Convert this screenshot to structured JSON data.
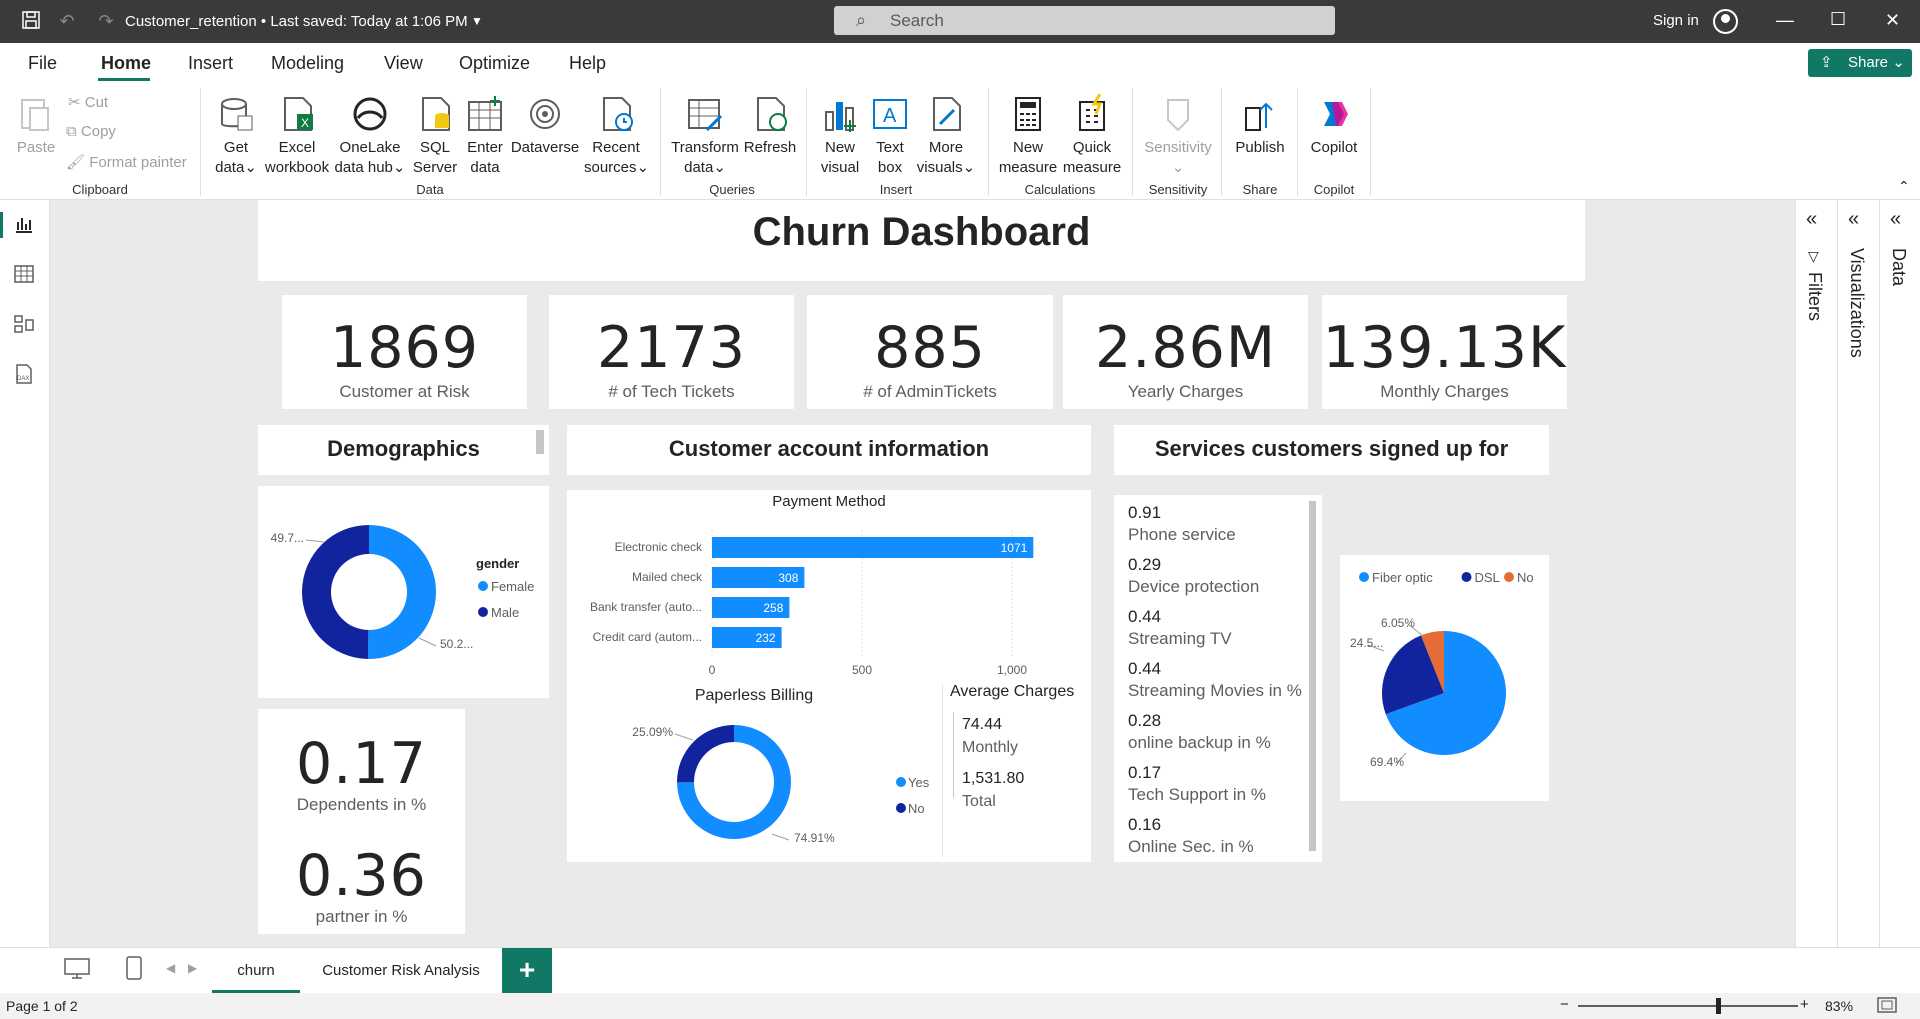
{
  "titlebar": {
    "document": "Customer_retention • Last saved: Today at 1:06 PM",
    "search_placeholder": "Search",
    "sign_in": "Sign in"
  },
  "menu": {
    "items": [
      "File",
      "Home",
      "Insert",
      "Modeling",
      "View",
      "Optimize",
      "Help"
    ],
    "share": "Share"
  },
  "ribbon": {
    "clipboard": {
      "paste": "Paste",
      "cut": "Cut",
      "copy": "Copy",
      "format_painter": "Format painter",
      "group": "Clipboard"
    },
    "data": {
      "get_data": [
        "Get",
        "data"
      ],
      "excel": [
        "Excel",
        "workbook"
      ],
      "onelake": [
        "OneLake",
        "data hub"
      ],
      "sql": [
        "SQL",
        "Server"
      ],
      "enter": [
        "Enter",
        "data"
      ],
      "dataverse": "Dataverse",
      "recent": [
        "Recent",
        "sources"
      ],
      "group": "Data"
    },
    "queries": {
      "transform": [
        "Transform",
        "data"
      ],
      "refresh": "Refresh",
      "group": "Queries"
    },
    "insert": {
      "new_visual": [
        "New",
        "visual"
      ],
      "text_box": [
        "Text",
        "box"
      ],
      "more_visuals": [
        "More",
        "visuals"
      ],
      "group": "Insert"
    },
    "calculations": {
      "new_measure": [
        "New",
        "measure"
      ],
      "quick_measure": [
        "Quick",
        "measure"
      ],
      "group": "Calculations"
    },
    "sensitivity": {
      "label": "Sensitivity",
      "group": "Sensitivity"
    },
    "share": {
      "publish": "Publish",
      "group": "Share"
    },
    "copilot": {
      "label": "Copilot",
      "group": "Copilot"
    }
  },
  "dashboard": {
    "title": "Churn Dashboard",
    "kpis": [
      {
        "value": "1869",
        "label": "Customer at Risk"
      },
      {
        "value": "2173",
        "label": "# of Tech Tickets"
      },
      {
        "value": "885",
        "label": "# of AdminTickets"
      },
      {
        "value": "2.86M",
        "label": "Yearly Charges"
      },
      {
        "value": "139.13K",
        "label": "Monthly Charges"
      }
    ],
    "sections": {
      "demographics": "Demographics",
      "account": "Customer account information",
      "services": "Services customers signed up for"
    },
    "dependents": {
      "value": "0.17",
      "label": "Dependents in %"
    },
    "partner": {
      "value": "0.36",
      "label": "partner in %"
    },
    "average_charges": {
      "title": "Average Charges",
      "monthly_value": "74.44",
      "monthly_label": "Monthly",
      "total_value": "1,531.80",
      "total_label": "Total"
    },
    "services": [
      {
        "value": "0.91",
        "label": "Phone service"
      },
      {
        "value": "0.29",
        "label": "Device protection"
      },
      {
        "value": "0.44",
        "label": "Streaming TV"
      },
      {
        "value": "0.44",
        "label": "Streaming Movies in %"
      },
      {
        "value": "0.28",
        "label": "online backup in %"
      },
      {
        "value": "0.17",
        "label": "Tech Support in %"
      },
      {
        "value": "0.16",
        "label": "Online Sec. in %"
      }
    ]
  },
  "chart_data": [
    {
      "type": "pie",
      "legend_title": "gender",
      "categories": [
        "Female",
        "Male"
      ],
      "values": [
        50.2,
        49.7
      ],
      "data_labels": [
        "50.2...",
        "49.7..."
      ],
      "colors": [
        "#118dff",
        "#12239e"
      ],
      "donut": true
    },
    {
      "type": "bar",
      "orientation": "horizontal",
      "title": "Payment Method",
      "categories": [
        "Electronic check",
        "Mailed check",
        "Bank transfer (auto...",
        "Credit card (autom..."
      ],
      "values": [
        1071,
        308,
        258,
        232
      ],
      "x_ticks": [
        "0",
        "500",
        "1,000"
      ],
      "xlim": [
        0,
        1100
      ],
      "color": "#118dff"
    },
    {
      "type": "pie",
      "title": "Paperless Billing",
      "categories": [
        "Yes",
        "No"
      ],
      "values": [
        74.91,
        25.09
      ],
      "data_labels": [
        "74.91%",
        "25.09%"
      ],
      "colors": [
        "#118dff",
        "#12239e"
      ],
      "donut": true
    },
    {
      "type": "pie",
      "categories": [
        "Fiber optic",
        "DSL",
        "No"
      ],
      "values": [
        69.4,
        24.5,
        6.05
      ],
      "data_labels": [
        "69.4%",
        "24.5...",
        "6.05%"
      ],
      "colors": [
        "#118dff",
        "#12239e",
        "#e66c37"
      ]
    }
  ],
  "tabs": [
    "churn",
    "Customer Risk Analysis"
  ],
  "status": {
    "page": "Page 1 of 2",
    "zoom": "83%"
  },
  "panes": {
    "filters": "Filters",
    "visualizations": "Visualizations",
    "data": "Data"
  }
}
